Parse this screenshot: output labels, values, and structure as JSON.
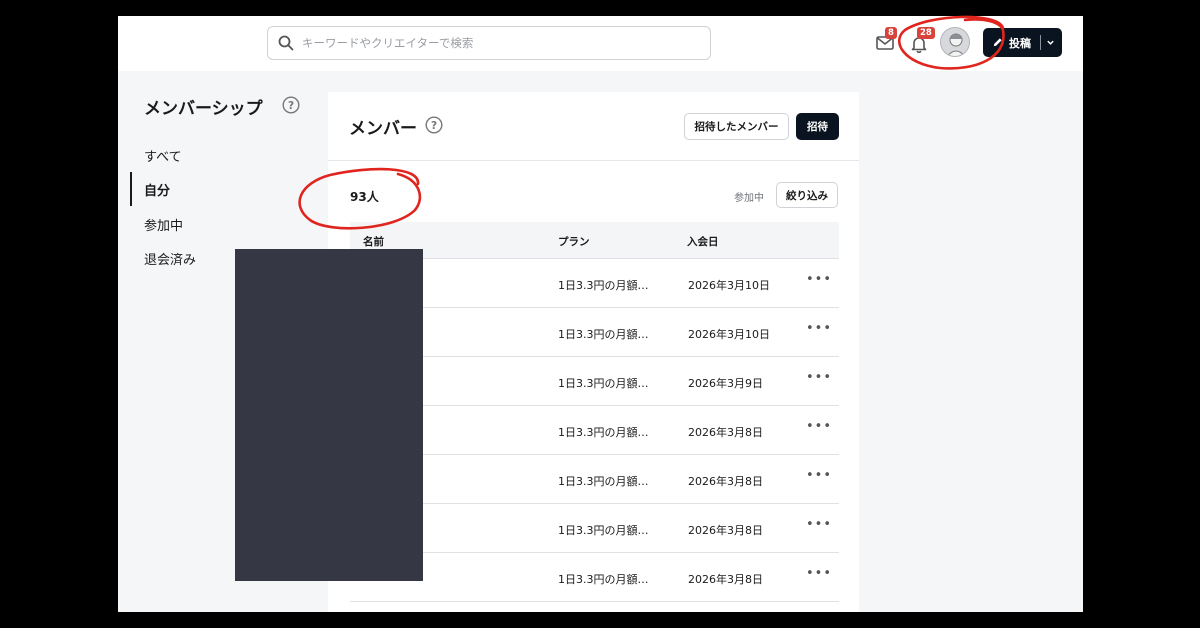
{
  "search": {
    "placeholder": "キーワードやクリエイターで検索"
  },
  "header": {
    "mail_badge": "8",
    "bell_badge": "28",
    "post_label": "投稿"
  },
  "sidebar": {
    "title": "メンバーシップ",
    "items": [
      {
        "label": "すべて"
      },
      {
        "label": "自分"
      },
      {
        "label": "参加中"
      },
      {
        "label": "退会済み"
      }
    ]
  },
  "main": {
    "title": "メンバー",
    "invited_members_label": "招待したメンバー",
    "invite_label": "招待",
    "member_count": "93人",
    "status_label": "参加中",
    "filter_label": "絞り込み",
    "columns": {
      "name": "名前",
      "plan": "プラン",
      "joined": "入会日"
    },
    "rows": [
      {
        "plan": "1日3.3円の月額…",
        "joined": "2026年3月10日"
      },
      {
        "plan": "1日3.3円の月額…",
        "joined": "2026年3月10日"
      },
      {
        "plan": "1日3.3円の月額…",
        "joined": "2026年3月9日"
      },
      {
        "plan": "1日3.3円の月額…",
        "joined": "2026年3月8日"
      },
      {
        "plan": "1日3.3円の月額…",
        "joined": "2026年3月8日"
      },
      {
        "plan": "1日3.3円の月額…",
        "joined": "2026年3月8日"
      },
      {
        "plan": "1日3.3円の月額…",
        "joined": "2026年3月8日"
      }
    ],
    "more_glyph": "•••"
  },
  "colors": {
    "accent_dark": "#0a1420",
    "badge_red": "#d9433b",
    "annotation_red": "#e0241e",
    "redaction": "#363745"
  },
  "icons": [
    "search-icon",
    "mail-icon",
    "bell-icon",
    "help-icon",
    "pen-icon",
    "chevron-down-icon",
    "more-icon"
  ]
}
